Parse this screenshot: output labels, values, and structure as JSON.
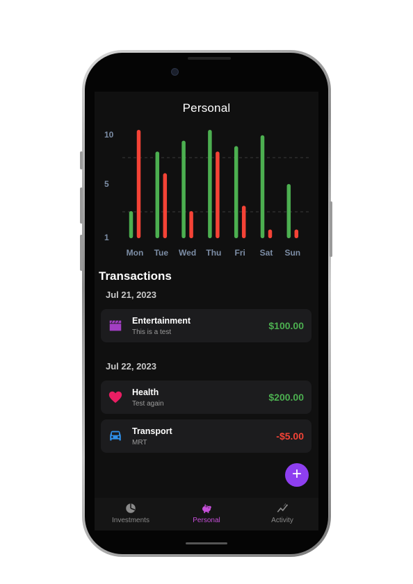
{
  "screen": {
    "title": "Personal"
  },
  "chart_data": {
    "type": "bar",
    "categories": [
      "Mon",
      "Tue",
      "Wed",
      "Thu",
      "Fri",
      "Sat",
      "Sun"
    ],
    "series": [
      {
        "color": "#4caf50",
        "values": [
          2.5,
          8,
          9,
          10,
          8.5,
          9.5,
          5
        ]
      },
      {
        "color": "#f44336",
        "values": [
          10,
          6,
          2.5,
          8,
          3,
          0.8,
          0.8
        ]
      }
    ],
    "y_ticks": [
      "10",
      "5",
      "1"
    ],
    "ylim": [
      0,
      10
    ],
    "grid": "dashed horizontal"
  },
  "transactions": {
    "section_title": "Transactions",
    "groups": [
      {
        "date": "Jul 21, 2023",
        "items": [
          {
            "icon": "clapperboard-icon",
            "name": "Entertainment",
            "note": "This is a test",
            "amount": "$100.00",
            "amount_color": "#4caf50"
          }
        ]
      },
      {
        "date": "Jul 22, 2023",
        "items": [
          {
            "icon": "heart-icon",
            "name": "Health",
            "note": "Test again",
            "amount": "$200.00",
            "amount_color": "#4caf50"
          },
          {
            "icon": "car-icon",
            "name": "Transport",
            "note": "MRT",
            "amount": "-$5.00",
            "amount_color": "#f44336"
          }
        ]
      }
    ]
  },
  "fab": {
    "label": "+",
    "color": "#8e3ff0"
  },
  "tabbar": {
    "tabs": [
      {
        "label": "Investments",
        "icon": "pie-chart-icon",
        "active": false
      },
      {
        "label": "Personal",
        "icon": "piggy-bank-icon",
        "active": true
      },
      {
        "label": "Activity",
        "icon": "activity-icon",
        "active": false
      }
    ],
    "active_color": "#c54fd8"
  }
}
